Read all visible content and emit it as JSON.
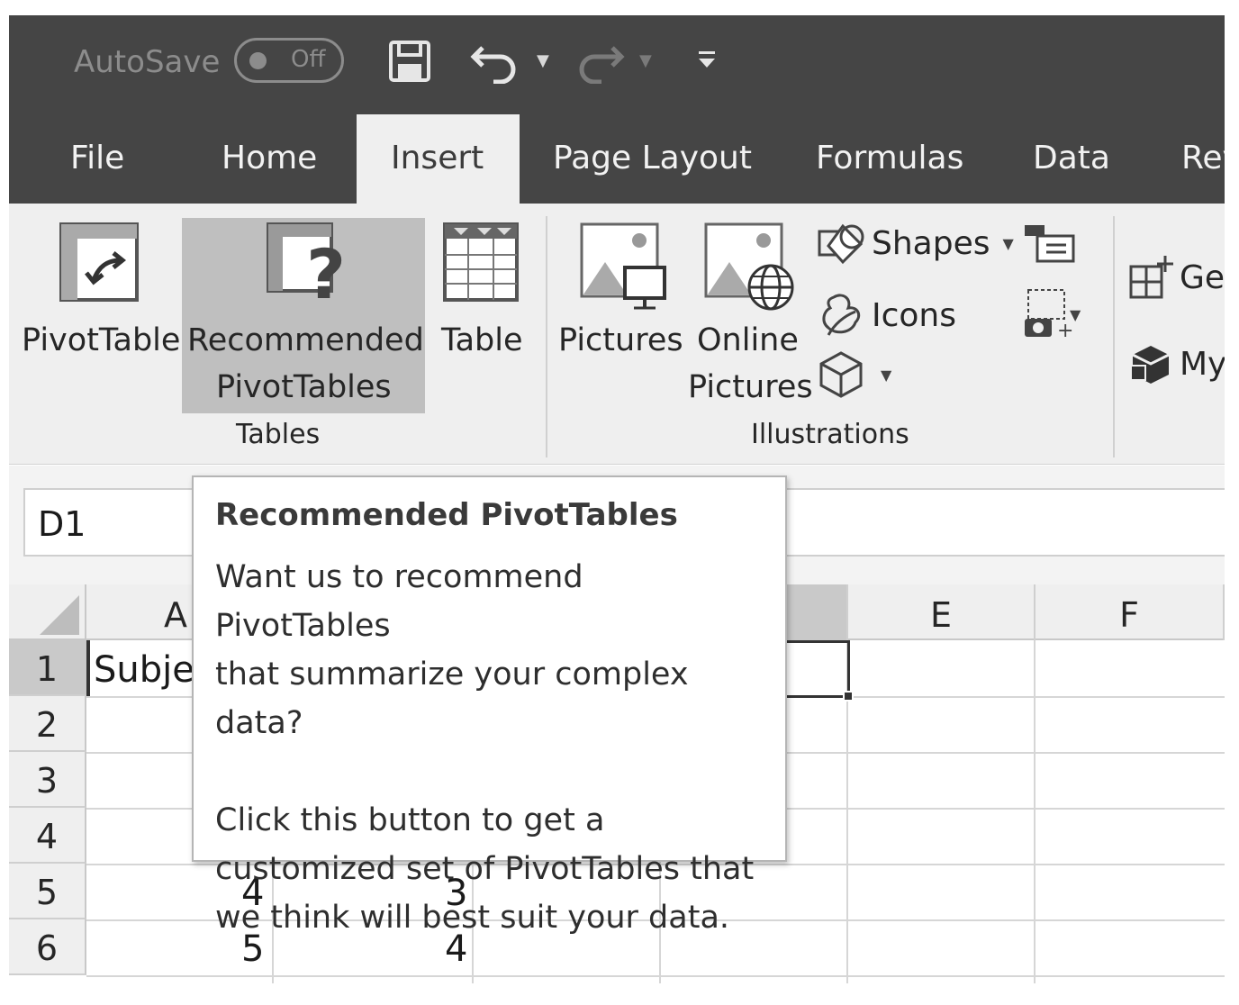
{
  "quick_access": {
    "autosave_label": "AutoSave",
    "autosave_state": "Off",
    "icons": [
      "save-icon",
      "undo-icon",
      "redo-icon",
      "customize-qat-icon"
    ]
  },
  "tabs": [
    "File",
    "Home",
    "Insert",
    "Page Layout",
    "Formulas",
    "Data",
    "Rev"
  ],
  "active_tab": "Insert",
  "ribbon": {
    "tables_group": {
      "label": "Tables",
      "pivot_table": "PivotTable",
      "recommended_line1": "Recommended",
      "recommended_line2": "PivotTables",
      "table": "Table"
    },
    "illustrations_group": {
      "label": "Illustrations",
      "pictures": "Pictures",
      "online_line1": "Online",
      "online_line2": "Pictures",
      "shapes": "Shapes",
      "icons": "Icons"
    },
    "addins_group": {
      "get": "Get",
      "my": "My"
    }
  },
  "name_box": "D1",
  "columns": [
    "A",
    "E",
    "F"
  ],
  "rows": [
    "1",
    "2",
    "3",
    "4",
    "5",
    "6"
  ],
  "cells": {
    "a1": "Subje",
    "b5": "4",
    "b6": "5",
    "c5": "3",
    "c6": "4"
  },
  "tooltip": {
    "title": "Recommended PivotTables",
    "para1": "Want us to recommend PivotTables\nthat summarize your complex data?",
    "para2": "Click this button to get a\ncustomized set of PivotTables that\nwe think will best suit your data."
  },
  "colors": {
    "titlebar": "#454545",
    "ribbon": "#efefef",
    "highlight": "#bfbfbf"
  }
}
